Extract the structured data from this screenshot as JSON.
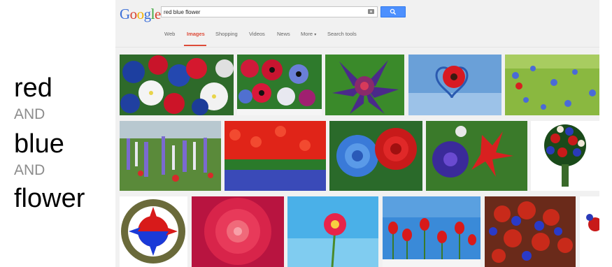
{
  "caption": {
    "word1": "red",
    "and1": "AND",
    "word2": "blue",
    "and2": "AND",
    "word3": "flower"
  },
  "google": {
    "logo_letters": [
      "G",
      "o",
      "o",
      "g",
      "l",
      "e"
    ],
    "logo_colors": [
      "#3b6fd8",
      "#d8412f",
      "#f2b100",
      "#3b6fd8",
      "#3aa53b",
      "#d8412f"
    ],
    "search_value": "red blue flower",
    "tabs": [
      {
        "label": "Web",
        "active": false
      },
      {
        "label": "Images",
        "active": true
      },
      {
        "label": "Shopping",
        "active": false
      },
      {
        "label": "Videos",
        "active": false
      },
      {
        "label": "News",
        "active": false
      },
      {
        "label": "More",
        "active": false
      },
      {
        "label": "Search tools",
        "active": false
      }
    ],
    "more_caret": "▾",
    "accent": "#dd4b39",
    "button_color": "#4d90fe"
  },
  "results": [
    {
      "subject": "petunias"
    },
    {
      "subject": "anemones"
    },
    {
      "subject": "bromeliad"
    },
    {
      "subject": "gerbera heart"
    },
    {
      "subject": "cornflower field"
    },
    {
      "subject": "larkspur field"
    },
    {
      "subject": "tulip field"
    },
    {
      "subject": "blue and red roses"
    },
    {
      "subject": "morning glory"
    },
    {
      "subject": "bouquet"
    },
    {
      "subject": "9th infantry patch"
    },
    {
      "subject": "dahlia"
    },
    {
      "subject": "gerbera sky"
    },
    {
      "subject": "tulips sky"
    },
    {
      "subject": "rose bouquet"
    }
  ]
}
